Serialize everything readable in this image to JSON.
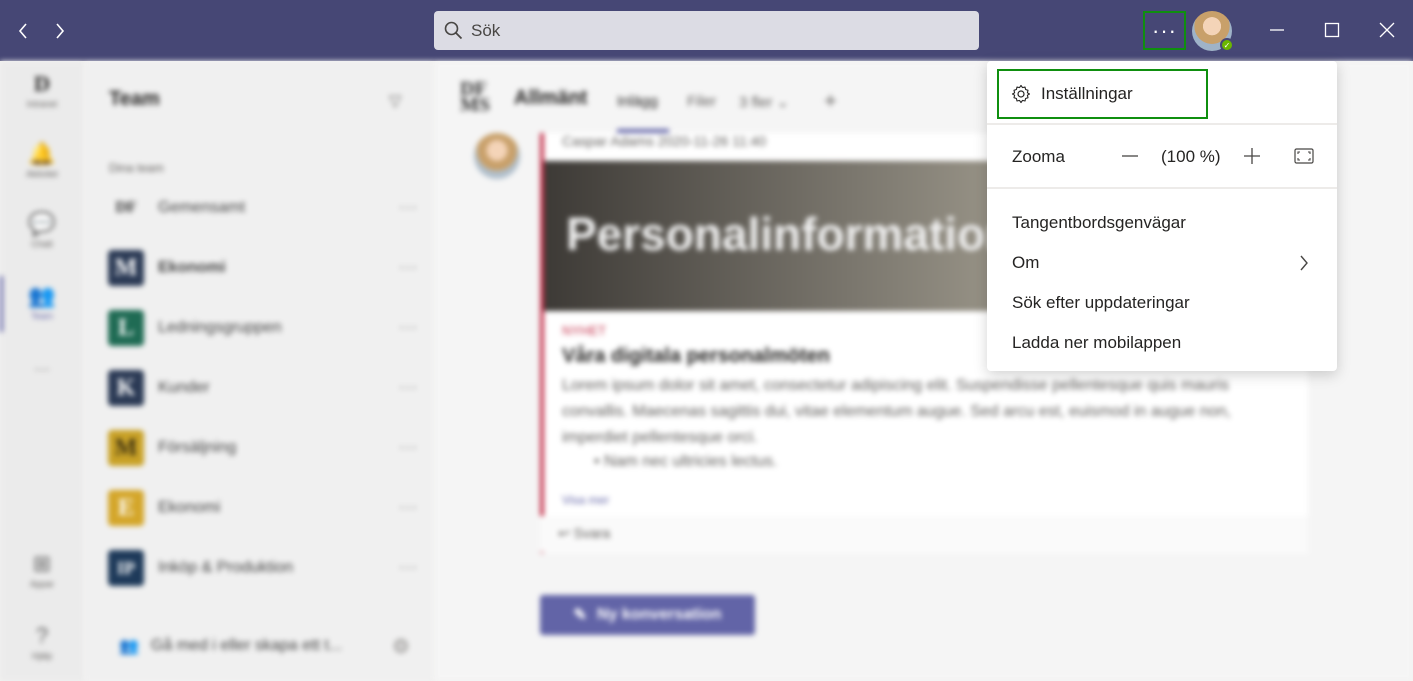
{
  "titlebar": {
    "search_placeholder": "Sök",
    "more_label": "···"
  },
  "rail": {
    "items": [
      {
        "label": "Intranet",
        "glyph": "D"
      },
      {
        "label": "Aktivitet",
        "glyph": "🔔"
      },
      {
        "label": "Chatt",
        "glyph": "💬"
      },
      {
        "label": "Team",
        "glyph": "👥"
      },
      {
        "label": "···",
        "glyph": ""
      },
      {
        "label": "Appar",
        "glyph": "⊞"
      },
      {
        "label": "Hjälp",
        "glyph": "?"
      }
    ]
  },
  "teams_panel": {
    "title": "Team",
    "section_label": "Dina team",
    "teams": [
      {
        "name": "Gemensamt",
        "initial": "DF",
        "color": "#f0f0f0"
      },
      {
        "name": "Ekonomi",
        "initial": "M",
        "color": "#2b3a55"
      },
      {
        "name": "Ledningsgruppen",
        "initial": "L",
        "color": "#1f6b54"
      },
      {
        "name": "Kunder",
        "initial": "K",
        "color": "#2b3a55"
      },
      {
        "name": "Försäljning",
        "initial": "M",
        "color": "#c9a227"
      },
      {
        "name": "Ekonomi",
        "initial": "E",
        "color": "#d4a62a"
      },
      {
        "name": "Inköp & Produktion",
        "initial": "IP",
        "color": "#1e3a5a"
      }
    ],
    "more_dots": "···",
    "join_label": "Gå med i eller skapa ett t..."
  },
  "main": {
    "channel_logo": "DF\nMS",
    "channel_name": "Allmänt",
    "tabs": [
      {
        "label": "Inlägg"
      },
      {
        "label": "Filer"
      },
      {
        "label": "3 fler ⌄"
      },
      {
        "label": "+"
      }
    ],
    "post": {
      "meta": "Caspar Adams  2020-11-26 11:40",
      "image_title": "Personalinformation",
      "tag": "NYHET",
      "heading": "Våra digitala personalmöten",
      "body": "Lorem ipsum dolor sit amet, consectetur adipiscing elit. Suspendisse pellentesque quis mauris convallis. Maecenas sagittis dui, vitae elementum augue. Sed arcu est, euismod in augue non, imperdiet pellentesque orci.",
      "bullet": "• Nam nec ultricies lectus.",
      "link": "Visa mer",
      "reply": "↩ Svara"
    },
    "new_conversation_label": "Ny konversation"
  },
  "menu": {
    "settings_label": "Inställningar",
    "zoom_label": "Zooma",
    "zoom_value": "(100 %)",
    "items": [
      {
        "label": "Tangentbordsgenvägar"
      },
      {
        "label": "Om"
      },
      {
        "label": "Sök efter uppdateringar"
      },
      {
        "label": "Ladda ner mobilappen"
      }
    ]
  }
}
